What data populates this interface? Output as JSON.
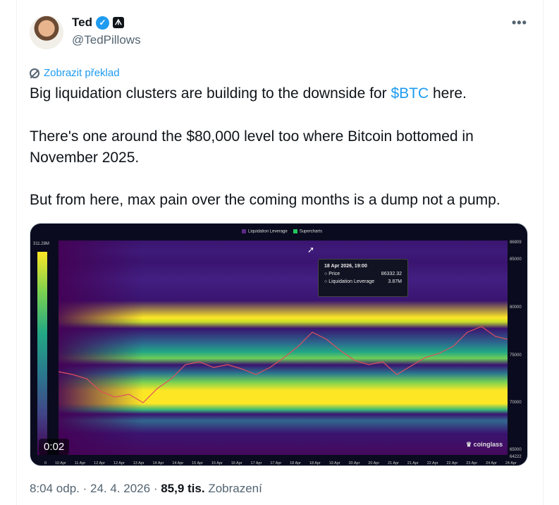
{
  "author": {
    "name": "Ted",
    "handle": "@TedPillows"
  },
  "translate_label": "Zobrazit překlad",
  "tweet": {
    "line1_pre": "Big liquidation clusters are building to the downside for ",
    "line1_cashtag": "$BTC",
    "line1_post": " here.",
    "line2": "There's one around the $80,000 level too where Bitcoin bottomed in",
    "line3": "November 2025.",
    "line4": "But from here, max pain over the coming months is a dump not a pump."
  },
  "chart": {
    "legend": [
      "Liquidation Leverage",
      "Supercharts"
    ],
    "colorbar_label": "311.28M",
    "colorbar_min": "0",
    "y_ticks": [
      "86909",
      "85000",
      "80000",
      "75000",
      "70000",
      "65000",
      "64222"
    ],
    "x_ticks": [
      "10 Apr",
      "11 Apr",
      "12 Apr",
      "12 Apr",
      "13 Apr",
      "14 Apr",
      "14 Apr",
      "15 Apr",
      "15 Apr",
      "16 Apr",
      "17 Apr",
      "17 Apr",
      "18 Apr",
      "18 Apr",
      "19 Apr",
      "20 Apr",
      "20 Apr",
      "21 Apr",
      "21 Apr",
      "22 Apr",
      "22 Apr",
      "23 Apr",
      "24 Apr",
      "24 Apr"
    ],
    "tooltip": {
      "time": "18 Apr 2026, 19:00",
      "price_label": "Price",
      "price_value": "86332.32",
      "lev_label": "Liquidation Leverage",
      "lev_value": "3.87M"
    },
    "watermark": "coinglass",
    "colors": {
      "yellow": "#fde725",
      "purple": "#3a1470",
      "teal": "#22a884"
    }
  },
  "video_timer": "0:02",
  "meta": {
    "time": "8:04 odp.",
    "date": "24. 4. 2026",
    "views": "85,9 tis.",
    "views_label": "Zobrazení"
  }
}
